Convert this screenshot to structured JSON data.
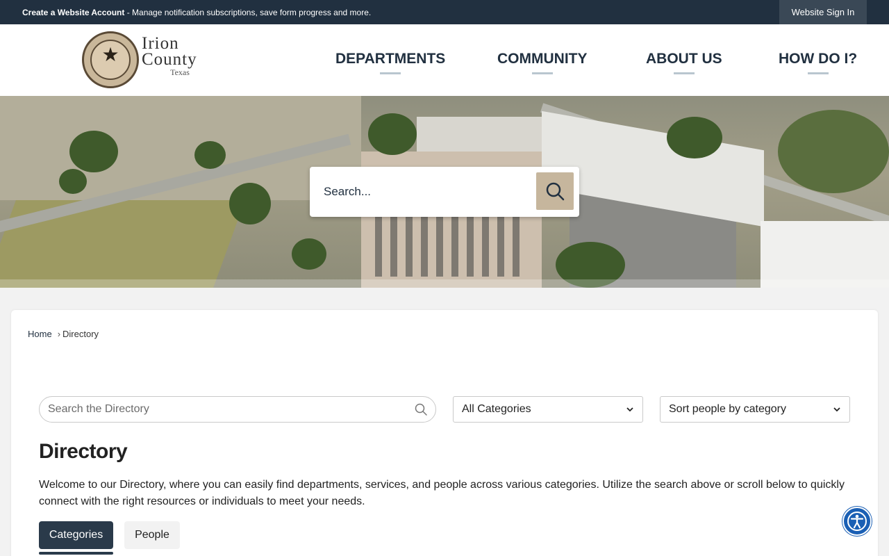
{
  "topbar": {
    "account_bold": "Create a Website Account",
    "account_rest": " - Manage notification subscriptions, save form progress and more.",
    "signin_label": "Website Sign In"
  },
  "logo": {
    "line1": "Irion",
    "line2": "County",
    "line3": "Texas",
    "seal_icon": "state-seal-star"
  },
  "nav": {
    "items": [
      {
        "label": "DEPARTMENTS"
      },
      {
        "label": "COMMUNITY"
      },
      {
        "label": "ABOUT US"
      },
      {
        "label": "HOW DO I?"
      }
    ]
  },
  "hero": {
    "search_placeholder": "Search...",
    "search_button_icon": "search-icon"
  },
  "breadcrumb": {
    "home": "Home",
    "separator": "›",
    "current": "Directory"
  },
  "directory": {
    "search_placeholder": "Search the Directory",
    "category_select": "All Categories",
    "sort_select": "Sort people by category",
    "title": "Directory",
    "intro": "Welcome to our Directory, where you can easily find departments, services, and people across various categories. Utilize the search above or scroll below to quickly connect with the right resources or individuals to meet your needs.",
    "tabs": [
      {
        "label": "Categories",
        "active": true
      },
      {
        "label": "People",
        "active": false
      }
    ]
  },
  "colors": {
    "navy": "#213040",
    "tan": "#c6b69d",
    "accessibility_blue": "#1a5fb4"
  }
}
